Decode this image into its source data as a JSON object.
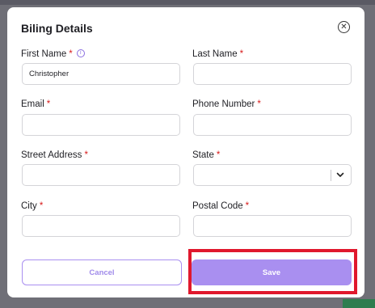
{
  "modal": {
    "title": "Biling Details"
  },
  "fields": {
    "first_name": {
      "label": "First Name",
      "required": "*",
      "value": "Christopher",
      "placeholder": ""
    },
    "last_name": {
      "label": "Last Name",
      "required": "*",
      "value": "",
      "placeholder": ""
    },
    "email": {
      "label": "Email",
      "required": "*",
      "value": "",
      "placeholder": ""
    },
    "phone": {
      "label": "Phone Number",
      "required": "*",
      "value": "",
      "placeholder": ""
    },
    "street": {
      "label": "Street Address",
      "required": "*",
      "value": "",
      "placeholder": ""
    },
    "state": {
      "label": "State",
      "required": "*",
      "selected": ""
    },
    "city": {
      "label": "City",
      "required": "*",
      "value": "",
      "placeholder": ""
    },
    "postal": {
      "label": "Postal Code",
      "required": "*",
      "value": "",
      "placeholder": ""
    }
  },
  "buttons": {
    "cancel_label": "Cancel",
    "save_label": "Save"
  },
  "icons": {
    "close": "close-icon",
    "info": "info-icon",
    "chevron": "chevron-down-icon"
  },
  "colors": {
    "accent": "#a98ff0",
    "required": "#d81b1b",
    "highlight": "#e0182d"
  }
}
